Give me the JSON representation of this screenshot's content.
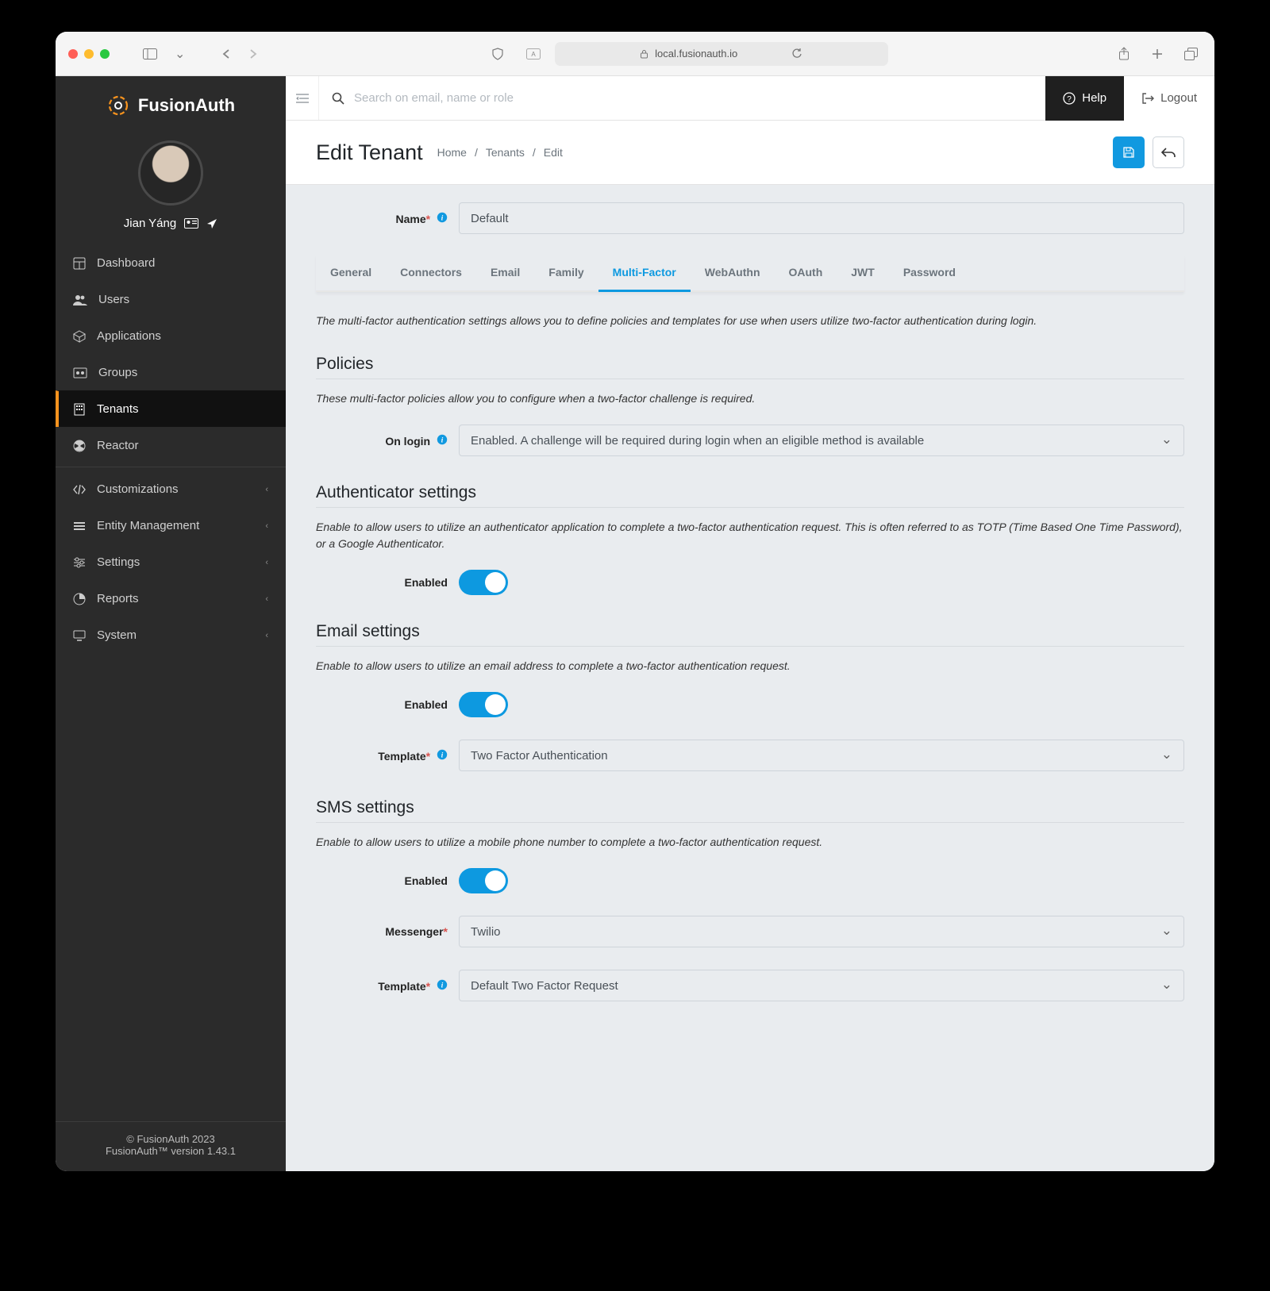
{
  "browser": {
    "url": "local.fusionauth.io"
  },
  "brand": "FusionAuth",
  "user": {
    "name": "Jian Yáng"
  },
  "topbar": {
    "search_placeholder": "Search on email, name or role",
    "help": "Help",
    "logout": "Logout"
  },
  "sidebar": {
    "items": [
      {
        "label": "Dashboard"
      },
      {
        "label": "Users"
      },
      {
        "label": "Applications"
      },
      {
        "label": "Groups"
      },
      {
        "label": "Tenants"
      },
      {
        "label": "Reactor"
      }
    ],
    "groups": [
      {
        "label": "Customizations"
      },
      {
        "label": "Entity Management"
      },
      {
        "label": "Settings"
      },
      {
        "label": "Reports"
      },
      {
        "label": "System"
      }
    ],
    "footer": {
      "copyright": "© FusionAuth 2023",
      "version": "FusionAuth™ version 1.43.1"
    }
  },
  "page": {
    "title": "Edit Tenant",
    "crumbs": [
      "Home",
      "Tenants",
      "Edit"
    ]
  },
  "form": {
    "name_label": "Name",
    "name_value": "Default"
  },
  "tabs": [
    "General",
    "Connectors",
    "Email",
    "Family",
    "Multi-Factor",
    "WebAuthn",
    "OAuth",
    "JWT",
    "Password"
  ],
  "active_tab": "Multi-Factor",
  "mfa": {
    "intro": "The multi-factor authentication settings allows you to define policies and templates for use when users utilize two-factor authentication during login.",
    "policies_title": "Policies",
    "policies_desc": "These multi-factor policies allow you to configure when a two-factor challenge is required.",
    "on_login_label": "On login",
    "on_login_value": "Enabled. A challenge will be required during login when an eligible method is available",
    "auth_title": "Authenticator settings",
    "auth_desc": "Enable to allow users to utilize an authenticator application to complete a two-factor authentication request. This is often referred to as TOTP (Time Based One Time Password), or a Google Authenticator.",
    "enabled_label": "Enabled",
    "email_title": "Email settings",
    "email_desc": "Enable to allow users to utilize an email address to complete a two-factor authentication request.",
    "template_label": "Template",
    "template_value": "Two Factor Authentication",
    "sms_title": "SMS settings",
    "sms_desc": "Enable to allow users to utilize a mobile phone number to complete a two-factor authentication request.",
    "messenger_label": "Messenger",
    "messenger_value": "Twilio",
    "sms_template_value": "Default Two Factor Request"
  }
}
